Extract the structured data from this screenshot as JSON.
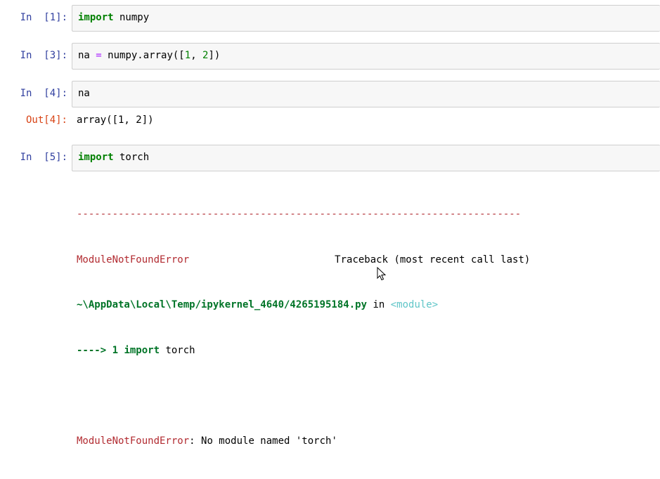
{
  "cells": [
    {
      "prompt": "In  [1]:",
      "code": {
        "kw": "import",
        "rest": " numpy"
      }
    },
    {
      "prompt": "In  [3]:",
      "code": {
        "a": "na ",
        "op": "=",
        "b": " numpy.array([",
        "n1": "1",
        "c": ", ",
        "n2": "2",
        "d": "])"
      }
    },
    {
      "prompt": "In  [4]:",
      "code": {
        "text": "na"
      },
      "out_prompt": "Out[4]:",
      "out_text": "array([1, 2])"
    },
    {
      "prompt": "In  [5]:",
      "code": {
        "kw": "import",
        "rest": " torch"
      },
      "traceback": {
        "separator": "---------------------------------------------------------------------------",
        "error_name": "ModuleNotFoundError",
        "header_right": "Traceback (most recent call last)",
        "file_path": "~\\AppData\\Local\\Temp/ipykernel_4640/4265195184.py",
        "in_word": " in ",
        "module_label": "<module>",
        "arrow_line": "----> 1 ",
        "arrow_kw": "import",
        "arrow_rest": " torch",
        "final_error_name": "ModuleNotFoundError",
        "final_message": ": No module named 'torch'"
      }
    }
  ]
}
